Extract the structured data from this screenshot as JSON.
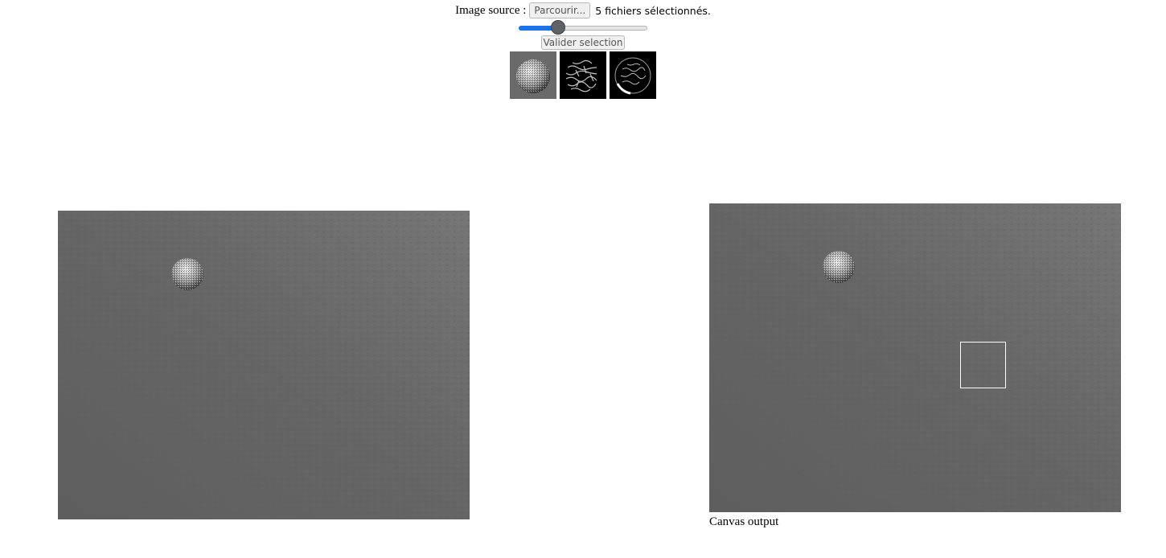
{
  "controls": {
    "source_label": "Image source :",
    "browse_button": "Parcourir...",
    "file_status": "5 fichiers sélectionnés.",
    "slider": {
      "value_fraction": 0.28
    },
    "validate_button": "Valider selection",
    "thumbnails": [
      "sphere-thumbnail",
      "horizontal-edges-thumbnail",
      "vertical-edges-thumbnail"
    ]
  },
  "canvases": {
    "output_caption": "Canvas output"
  },
  "colors": {
    "surface": "#686868",
    "accent": "#1a73e8",
    "selection": "#ffffff"
  }
}
